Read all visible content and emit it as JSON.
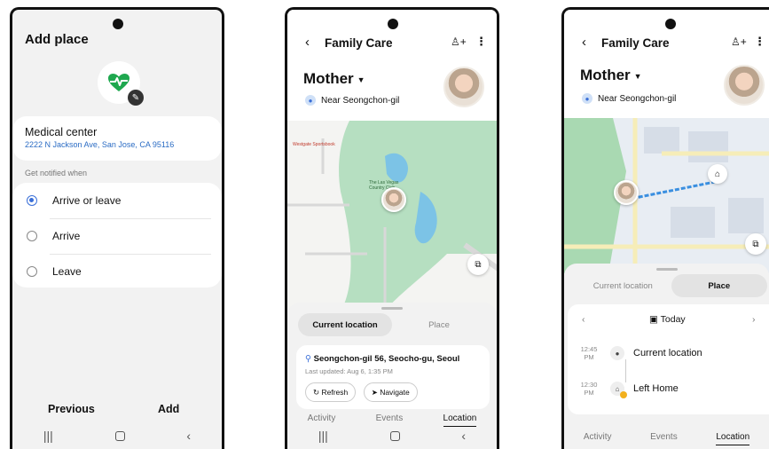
{
  "screen1": {
    "title": "Add place",
    "place_name": "Medical center",
    "place_address": "2222 N Jackson Ave, San Jose, CA 95116",
    "notify_label": "Get notified when",
    "options": [
      "Arrive or leave",
      "Arrive",
      "Leave"
    ],
    "selected_option": "Arrive or leave",
    "previous_button": "Previous",
    "add_button": "Add",
    "icon": "heart-pulse-icon",
    "accent_color": "#1fa84f"
  },
  "screen2": {
    "app_title": "Family Care",
    "person": "Mother",
    "location_near": "Near Seongchon-gil",
    "map_labels": [
      "Westgate Sportsbook",
      "The Las Vegas Country Club"
    ],
    "segments": [
      "Current location",
      "Place"
    ],
    "active_segment": "Current location",
    "address": "Seongchon-gil 56, Seocho-gu, Seoul",
    "last_updated": "Last updated: Aug 6, 1:35 PM",
    "refresh_button": "Refresh",
    "navigate_button": "Navigate",
    "tabs": [
      "Activity",
      "Events",
      "Location"
    ],
    "active_tab": "Location"
  },
  "screen3": {
    "app_title": "Family Care",
    "person": "Mother",
    "location_near": "Near Seongchon-gil",
    "segments": [
      "Current location",
      "Place"
    ],
    "active_segment": "Place",
    "date_label": "Today",
    "timeline": [
      {
        "time": "12:45",
        "ampm": "PM",
        "label": "Current location",
        "icon": "location-pin-icon"
      },
      {
        "time": "12:30",
        "ampm": "PM",
        "label": "Left Home",
        "icon": "home-icon"
      }
    ],
    "tabs": [
      "Activity",
      "Events",
      "Location"
    ],
    "active_tab": "Location"
  }
}
